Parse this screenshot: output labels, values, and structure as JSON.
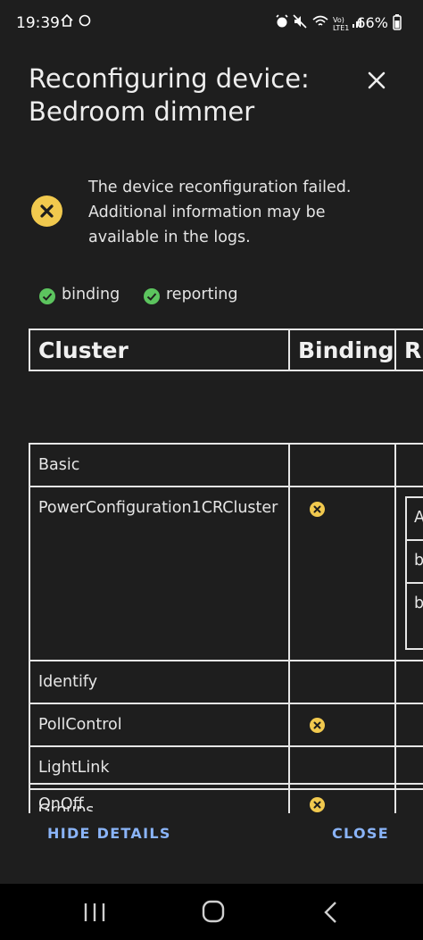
{
  "status_bar": {
    "time": "19:39",
    "battery": "66%",
    "network": "LTE1"
  },
  "dialog": {
    "title": "Reconfiguring device:\nBedroom dimmer",
    "status_message": "The device reconfiguration failed. Additional information may be available in the logs.",
    "chips": [
      {
        "label": "binding",
        "state": "success"
      },
      {
        "label": "reporting",
        "state": "success"
      }
    ],
    "table": {
      "headers": [
        "Cluster",
        "Binding",
        "R"
      ],
      "rows": [
        {
          "cluster": "Basic",
          "binding": "",
          "binding_failed": false
        },
        {
          "cluster": "PowerConfiguration1CRCluster",
          "binding": "",
          "binding_failed": true,
          "reporting_items": [
            "A",
            "b",
            "b"
          ]
        },
        {
          "cluster": "Identify",
          "binding": "",
          "binding_failed": false
        },
        {
          "cluster": "PollControl",
          "binding": "",
          "binding_failed": true
        },
        {
          "cluster": "LightLink",
          "binding": "",
          "binding_failed": false
        },
        {
          "cluster": "Groups",
          "binding": "",
          "binding_failed": false
        },
        {
          "cluster": "OnOff",
          "binding": "",
          "binding_failed": true
        }
      ]
    },
    "actions": {
      "hide_details": "HIDE DETAILS",
      "close": "CLOSE"
    }
  },
  "colors": {
    "background": "#1e1e1e",
    "accent": "#8ab4f8",
    "error": "#f1c94e",
    "success": "#5cc45e"
  }
}
